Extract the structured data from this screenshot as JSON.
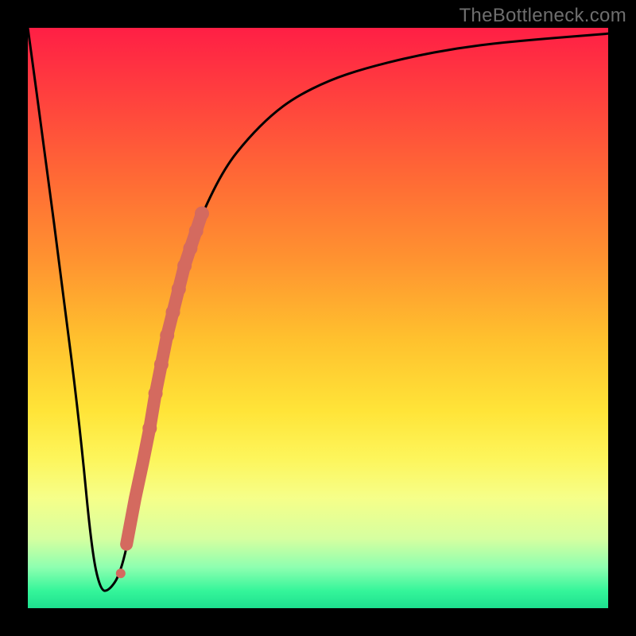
{
  "attribution": "TheBottleneck.com",
  "chart_data": {
    "type": "line",
    "title": "",
    "xlabel": "",
    "ylabel": "",
    "xlim": [
      0,
      100
    ],
    "ylim": [
      0,
      100
    ],
    "x": [
      0,
      3,
      6,
      9,
      11,
      12.5,
      14,
      16,
      18,
      20,
      22,
      24,
      26,
      28,
      30,
      34,
      38,
      42,
      46,
      52,
      58,
      66,
      74,
      82,
      90,
      100
    ],
    "values": [
      100,
      78,
      55,
      31,
      10,
      3,
      3,
      6,
      15,
      26,
      37,
      47,
      55,
      62,
      68,
      76,
      81,
      85,
      88,
      91,
      93,
      95,
      96.5,
      97.5,
      98.2,
      99
    ],
    "highlights_x": [
      17.0,
      18.5,
      19.8,
      21.0,
      22.0,
      23.0,
      24.0,
      25.0,
      26.0,
      27.0,
      28.0,
      29.0,
      30.0
    ],
    "highlights_y": [
      11,
      19,
      25,
      31,
      37,
      42,
      47,
      51,
      55,
      59,
      62,
      65,
      68
    ],
    "highlight_radii": [
      6,
      6,
      6,
      9,
      9,
      9,
      9,
      9,
      9,
      9,
      9,
      9,
      9
    ],
    "separate_dots_x": [
      16.0,
      20.5,
      21.4
    ],
    "separate_dots_y": [
      6,
      28,
      33
    ],
    "separate_dots_r": [
      6,
      7,
      7
    ],
    "colors": {
      "curve": "#000000",
      "highlight": "#d46a5f"
    }
  }
}
